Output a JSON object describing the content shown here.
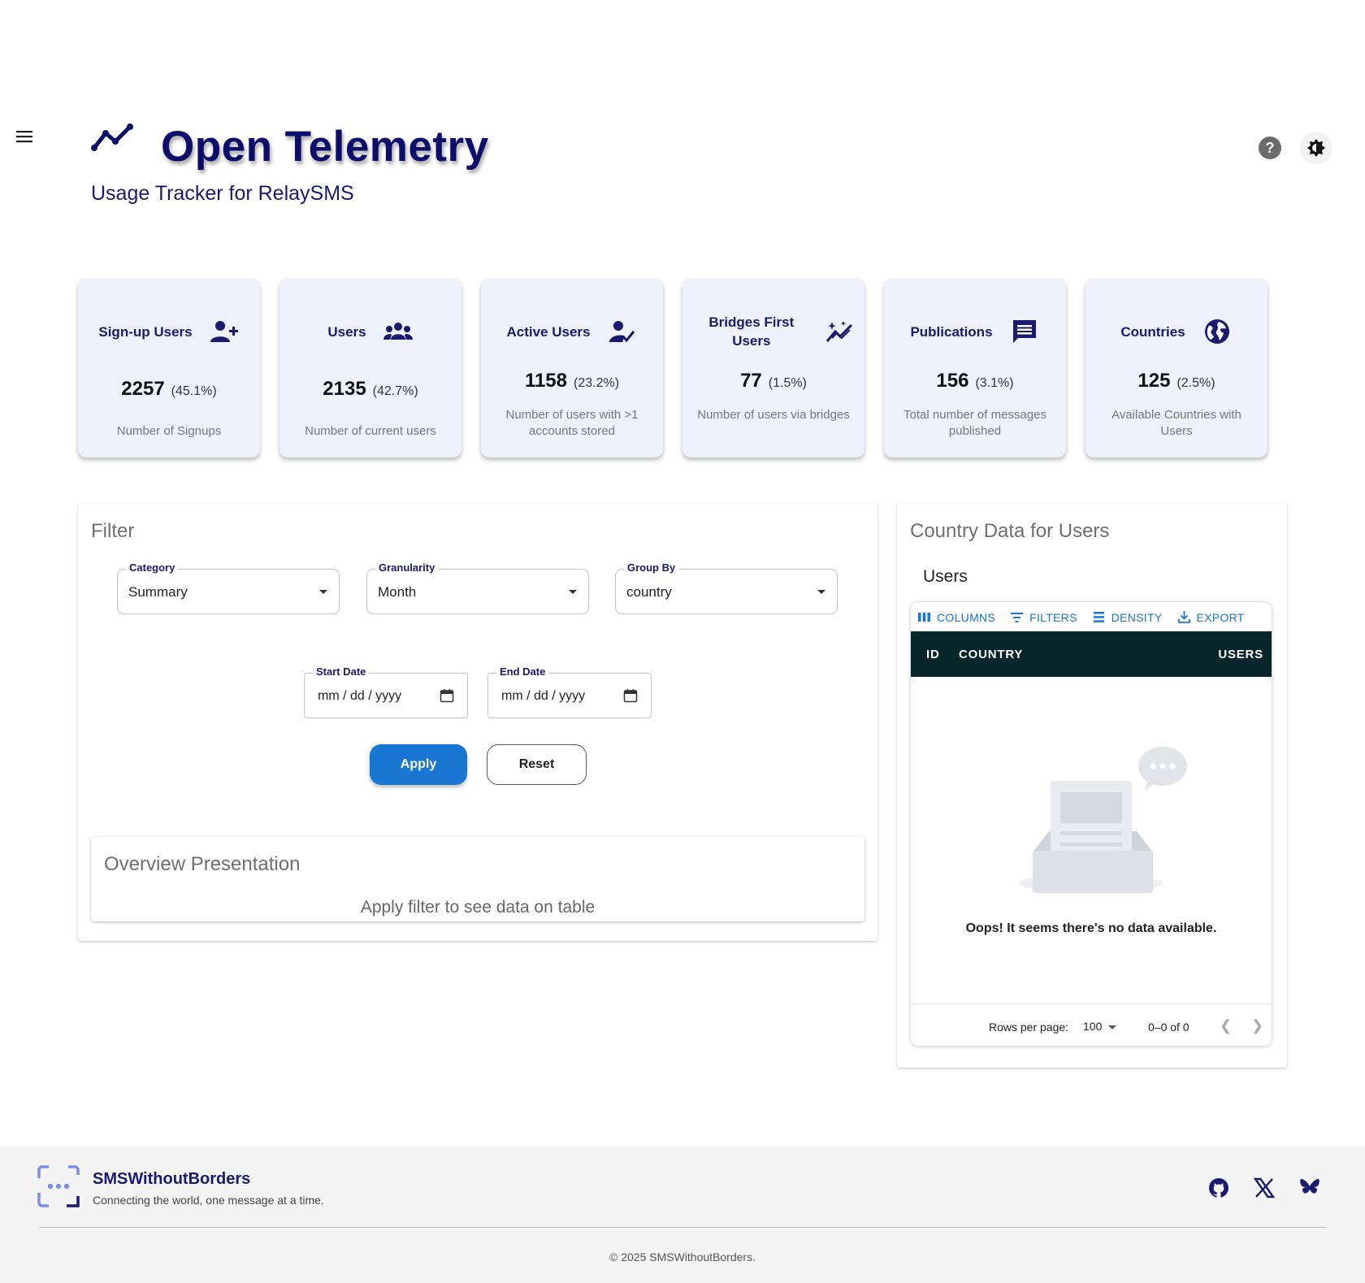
{
  "header": {
    "title": "Open Telemetry",
    "subtitle": "Usage Tracker for RelaySMS",
    "icons": {
      "menu": "menu-icon",
      "logo": "trending-line-icon",
      "help": "help-icon",
      "theme": "brightness-icon"
    }
  },
  "cards": [
    {
      "title": "Sign-up Users",
      "icon": "person-add-icon",
      "value": "2257",
      "pct": "(45.1%)",
      "desc": "Number of Signups"
    },
    {
      "title": "Users",
      "icon": "groups-icon",
      "value": "2135",
      "pct": "(42.7%)",
      "desc": "Number of current users"
    },
    {
      "title": "Active Users",
      "icon": "person-check-icon",
      "value": "1158",
      "pct": "(23.2%)",
      "desc": "Number of users with >1 accounts stored"
    },
    {
      "title": "Bridges First Users",
      "icon": "auto-graph-icon",
      "value": "77",
      "pct": "(1.5%)",
      "desc": "Number of users via bridges"
    },
    {
      "title": "Publications",
      "icon": "message-icon",
      "value": "156",
      "pct": "(3.1%)",
      "desc": "Total number of messages published"
    },
    {
      "title": "Countries",
      "icon": "globe-icon",
      "value": "125",
      "pct": "(2.5%)",
      "desc": "Available Countries with Users"
    }
  ],
  "filter": {
    "title": "Filter",
    "category": {
      "label": "Category",
      "value": "Summary"
    },
    "granularity": {
      "label": "Granularity",
      "value": "Month"
    },
    "group_by": {
      "label": "Group By",
      "value": "country"
    },
    "start_date": {
      "label": "Start Date",
      "value": "mm / dd / yyyy"
    },
    "end_date": {
      "label": "End Date",
      "value": "mm / dd / yyyy"
    },
    "apply_label": "Apply",
    "reset_label": "Reset"
  },
  "overview": {
    "title": "Overview Presentation",
    "message": "Apply filter to see data on table"
  },
  "country": {
    "title": "Country Data for Users",
    "subtitle": "Users",
    "toolbar": {
      "columns": "COLUMNS",
      "filters": "FILTERS",
      "density": "DENSITY",
      "export": "EXPORT"
    },
    "columns": {
      "id": "ID",
      "country": "COUNTRY",
      "users": "USERS"
    },
    "empty_message": "Oops! It seems there's no data available.",
    "footer": {
      "rows_per_page_label": "Rows per page:",
      "rows_per_page_value": "100",
      "range": "0–0 of 0"
    }
  },
  "footer": {
    "brand": "SMSWithoutBorders",
    "tagline": "Connecting the world, one message at a time.",
    "copyright": "© 2025 SMSWithoutBorders.",
    "social": [
      "github-icon",
      "x-icon",
      "bluesky-icon"
    ]
  },
  "colors": {
    "navy": "#1a1a6e",
    "accent": "#1976d2",
    "card_bg": "#eef1fb",
    "grid_header": "#06262b"
  }
}
